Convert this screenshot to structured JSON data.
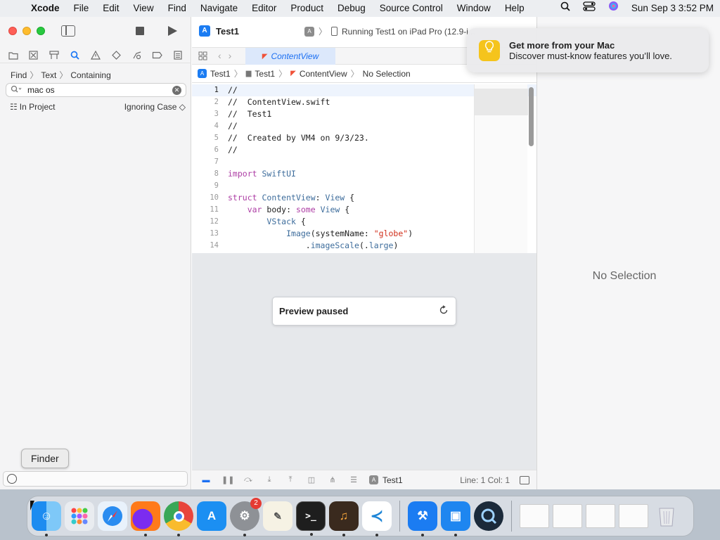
{
  "menubar": {
    "apple": "",
    "app": "Xcode",
    "items": [
      "File",
      "Edit",
      "View",
      "Find",
      "Navigate",
      "Editor",
      "Product",
      "Debug",
      "Source Control",
      "Window",
      "Help"
    ],
    "clock": "Sun Sep 3  3:52 PM"
  },
  "toolbar": {
    "project": "Test1",
    "run_status": "Running Test1 on iPad Pro (12.9-i..."
  },
  "navigator": {
    "crumbs": [
      "Find",
      "Text",
      "Containing"
    ],
    "search_value": "mac os",
    "scope": "In Project",
    "case": "Ignoring Case ◇"
  },
  "tab": {
    "label": "ContentView"
  },
  "jumpbar": [
    "Test1",
    "Test1",
    "ContentView",
    "No Selection"
  ],
  "code_lines": [
    "//",
    "//  ContentView.swift",
    "//  Test1",
    "//",
    "//  Created by VM4 on 9/3/23.",
    "//",
    "",
    "import SwiftUI",
    "",
    "struct ContentView: View {",
    "    var body: some View {",
    "        VStack {",
    "            Image(systemName: \"globe\")",
    "                .imageScale(.large)"
  ],
  "preview": {
    "status": "Preview paused"
  },
  "editor_bottom": {
    "scheme": "Test1",
    "position": "Line: 1  Col: 1"
  },
  "inspector": {
    "empty": "No Selection"
  },
  "notification": {
    "title": "Get more from your Mac",
    "body": "Discover must-know features you’ll love."
  },
  "tooltip": "Finder",
  "dock": {
    "settings_badge": "2",
    "apps": [
      "Finder",
      "Launchpad",
      "Safari",
      "Firefox",
      "Chrome",
      "App Store",
      "System Settings",
      "TextEdit",
      "Terminal",
      "GarageBand",
      "VS Code",
      "Xcode",
      "Simulator",
      "QuickTime Player"
    ]
  },
  "colors": {
    "accent": "#1b6ff2",
    "keyword": "#ad3da4",
    "string": "#d12f1b",
    "comment": "#707f8c"
  }
}
